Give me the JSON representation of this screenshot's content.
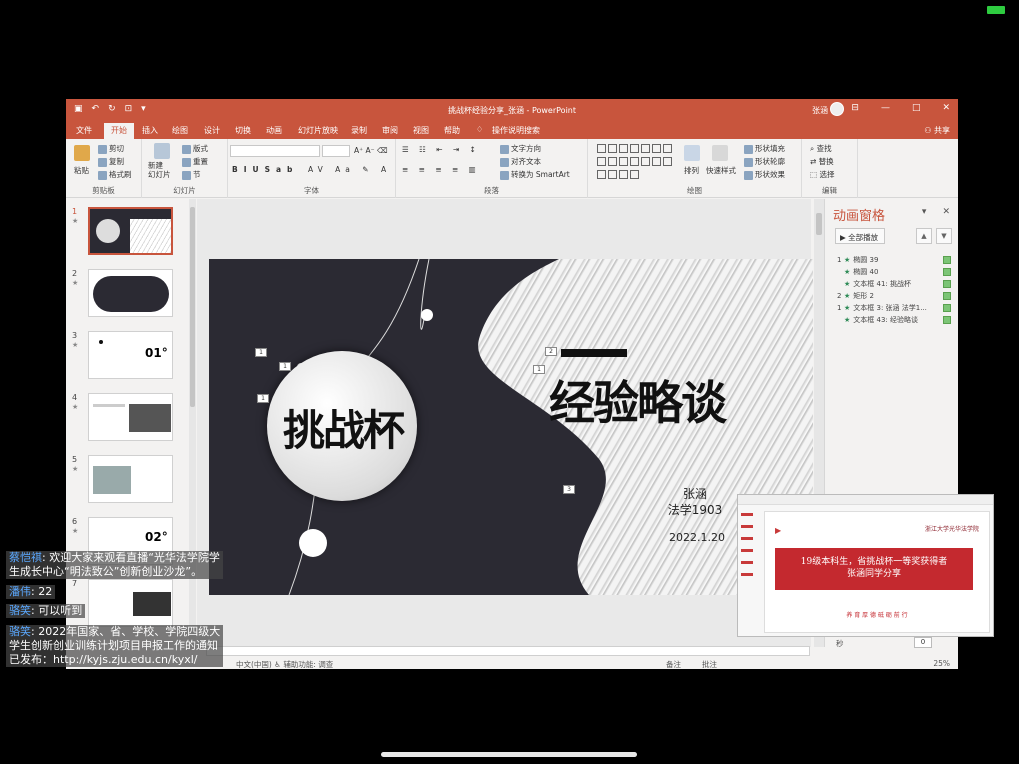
{
  "window": {
    "title": "挑战杯经验分享_张涵 - PowerPoint",
    "user": "张涵",
    "share": "共享"
  },
  "ribbon_tabs": [
    "文件",
    "开始",
    "插入",
    "绘图",
    "设计",
    "切换",
    "动画",
    "幻灯片放映",
    "录制",
    "审阅",
    "视图",
    "帮助",
    "操作说明搜索"
  ],
  "ribbon": {
    "clipboard": {
      "paste": "粘贴",
      "cut": "剪切",
      "copy": "复制",
      "format_painter": "格式刷",
      "label": "剪贴板"
    },
    "slides": {
      "new_slide": "新建\n幻灯片",
      "layout": "版式",
      "reset": "重置",
      "section": "节",
      "label": "幻灯片"
    },
    "font": {
      "label": "字体"
    },
    "paragraph": {
      "text_direction": "文字方向",
      "align_text": "对齐文本",
      "smartart": "转换为 SmartArt",
      "label": "段落"
    },
    "drawing": {
      "arrange": "排列",
      "quick_styles": "快速样式",
      "shape_fill": "形状填充",
      "shape_outline": "形状轮廓",
      "shape_effects": "形状效果",
      "label": "绘图"
    },
    "editing": {
      "find": "查找",
      "replace": "替换",
      "select": "选择",
      "label": "编辑"
    }
  },
  "thumbnails": [
    "1",
    "2",
    "3",
    "4",
    "5",
    "6",
    "7"
  ],
  "slide": {
    "circle_text": "挑战杯",
    "title": "经验略谈",
    "author": "张涵",
    "major": "法学1903",
    "date": "2022.1.20",
    "anim_tags": [
      "1",
      "1",
      "1",
      "2",
      "1",
      "3"
    ]
  },
  "animation_pane": {
    "title": "动画窗格",
    "play_all": "全部播放",
    "items": [
      {
        "num": "1",
        "label": "椭圆 39"
      },
      {
        "num": "",
        "label": "椭圆 40"
      },
      {
        "num": "",
        "label": "文本框 41: 挑战杯"
      },
      {
        "num": "2",
        "label": "矩形 2"
      },
      {
        "num": "1",
        "label": "文本框 3: 张涵 法学1..."
      },
      {
        "num": "",
        "label": "文本框 43: 经验略谈"
      }
    ],
    "seconds": "秒",
    "seconds_value": "0"
  },
  "statusbar": {
    "left": "中文(中国)   ♿ 辅助功能: 调查",
    "notes": "备注",
    "comments": "批注",
    "zoom": "25%"
  },
  "pip": {
    "band_text_1": "19级本科生，省挑战杯一等奖获得者",
    "band_text_2": "张涵同学分享",
    "logo": "浙江大学光华法学院",
    "footer": "养 育 厚 德   砥 砺 前 行"
  },
  "chat": [
    {
      "name": "蔡恺祺",
      "lines": [
        "欢迎大家来观看直播“光华法学院学",
        "生成长中心“明法致公”创新创业沙龙”。"
      ]
    },
    {
      "name": "潘伟",
      "lines": [
        "22"
      ]
    },
    {
      "name": "骆笑",
      "lines": [
        "可以听到"
      ]
    },
    {
      "name": "骆笑",
      "lines": [
        "2022年国家、省、学校、学院四级大",
        "学生创新创业训练计划项目申报工作的通知",
        "已发布：http://kyjs.zju.edu.cn/kyxl/"
      ]
    }
  ],
  "colors": {
    "accent": "#c8553d",
    "chat_name": "#5aa8ff",
    "slide_dark": "#2b2a33",
    "pip_red": "#c4292f"
  }
}
